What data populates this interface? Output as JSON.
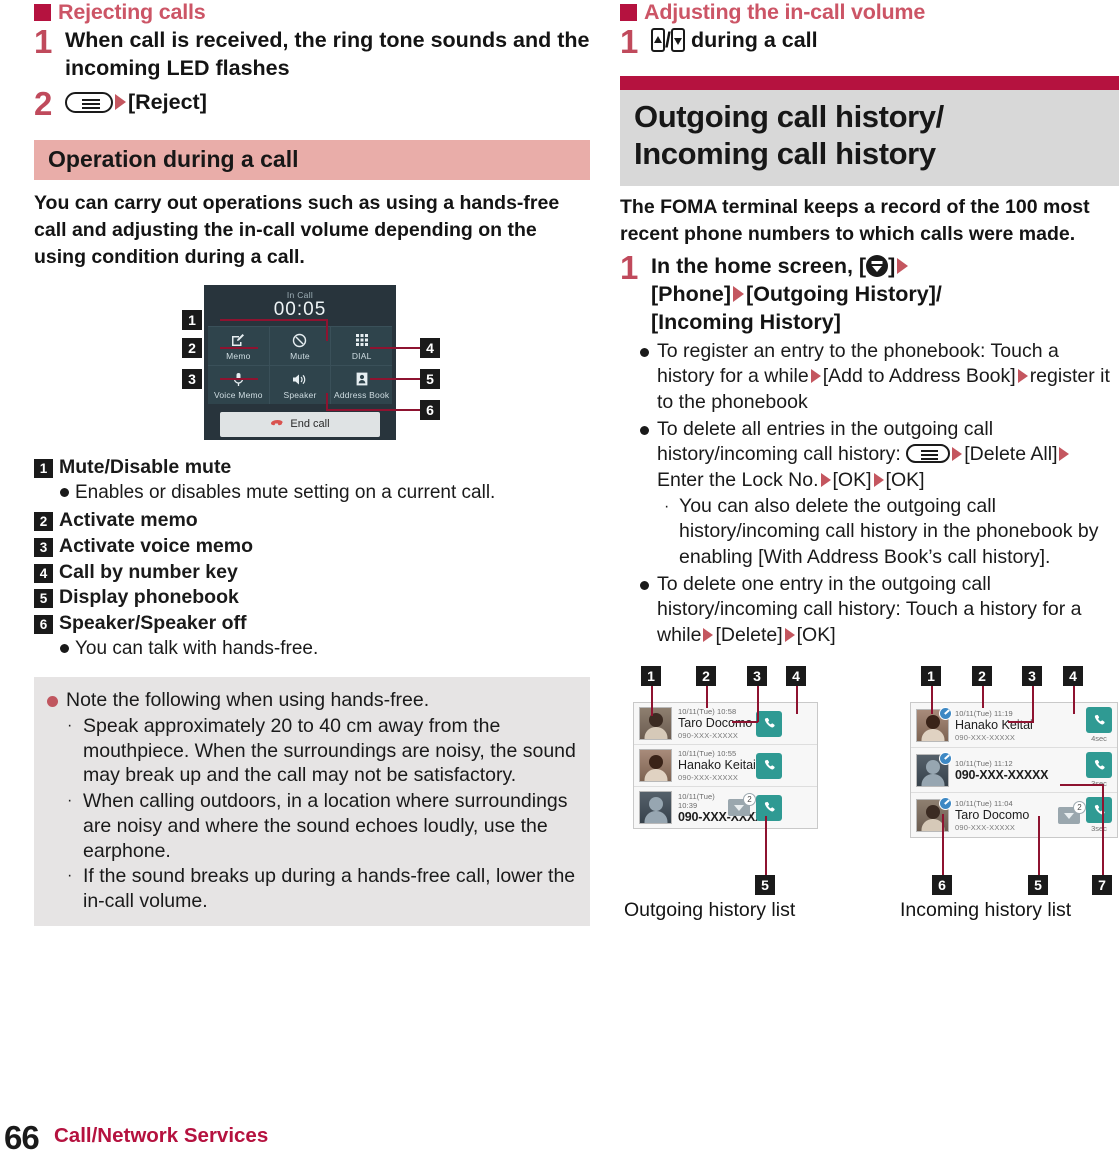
{
  "left": {
    "section1": {
      "title": "Rejecting calls"
    },
    "steps": [
      {
        "num": "1",
        "text": "When call is received, the ring tone sounds and the incoming LED flashes"
      },
      {
        "num": "2",
        "text_after": "[Reject]"
      }
    ],
    "operation_bar": "Operation during a call",
    "intro": "You can carry out operations such as using a hands-free call and adjusting the in-call volume depending on the using condition during a call.",
    "phone_mock": {
      "status": "In Call",
      "timer": "00:05",
      "cells": [
        {
          "icon": "memo-icon",
          "label": "Memo"
        },
        {
          "icon": "mute-icon",
          "label": "Mute"
        },
        {
          "icon": "dial-keypad-icon",
          "label": "DIAL"
        },
        {
          "icon": "voice-memo-icon",
          "label": "Voice Memo"
        },
        {
          "icon": "speaker-icon",
          "label": "Speaker"
        },
        {
          "icon": "address-book-icon",
          "label": "Address Book"
        }
      ],
      "end_call": "End call",
      "callouts": [
        "1",
        "2",
        "3",
        "4",
        "5",
        "6"
      ]
    },
    "definitions": [
      {
        "num": "1",
        "term": "Mute/Disable mute",
        "note": "Enables or disables mute setting on a current call."
      },
      {
        "num": "2",
        "term": "Activate memo",
        "note": ""
      },
      {
        "num": "3",
        "term": "Activate voice memo",
        "note": ""
      },
      {
        "num": "4",
        "term": "Call by number key",
        "note": ""
      },
      {
        "num": "5",
        "term": "Display phonebook",
        "note": ""
      },
      {
        "num": "6",
        "term": "Speaker/Speaker off",
        "note": "You can talk with hands-free."
      }
    ],
    "note_box": {
      "head": "Note the following when using hands-free.",
      "items": [
        "Speak approximately 20 to 40 cm away from the mouthpiece. When the surroundings are noisy, the sound may break up and the call may not be satisfactory.",
        "When calling outdoors, in a location where surroundings are noisy and where the sound echoes loudly, use the earphone.",
        "If the sound breaks up during a hands-free call, lower the in-call volume."
      ]
    }
  },
  "right": {
    "section1": {
      "title": "Adjusting the in-call volume"
    },
    "step1_text": "during a call",
    "step1_num": "1",
    "chapter_title_line1": "Outgoing call history/",
    "chapter_title_line2": "Incoming call history",
    "lead": "The FOMA terminal keeps a record of the 100 most recent phone numbers to which calls were made.",
    "step_num": "1",
    "step_a": "In the home screen, ",
    "step_b": "[Phone]",
    "step_c": "[Outgoing History]/",
    "step_d": "[Incoming History]",
    "bullets": [
      {
        "type": "dot",
        "parts": [
          "To register an entry to the phonebook: Touch a history for a while",
          "[Add to Address Book]",
          "register it to the phonebook"
        ]
      },
      {
        "type": "dot",
        "parts": [
          "To delete all entries in the outgoing call history/incoming call history:",
          "[Delete All]",
          " Enter the Lock No.",
          "[OK]",
          "[OK]"
        ]
      },
      {
        "type": "sub",
        "parts": [
          "You can also delete the outgoing call history/incoming call history in the phonebook by enabling [With Address Book’s call history]."
        ]
      },
      {
        "type": "dot",
        "parts": [
          "To delete one entry in the outgoing call history/incoming call history: Touch a history for a while",
          "[Delete]",
          "[OK]"
        ]
      }
    ],
    "outgoing_list": {
      "caption": "Outgoing history list",
      "callouts": [
        "1",
        "2",
        "3",
        "4",
        "5"
      ],
      "rows": [
        {
          "date": "10/11(Tue) 10:58",
          "name": "Taro Docomo",
          "number": "090-XXX-XXXXX",
          "avatar": "male-photo",
          "edit_badge": false,
          "dropdown": "",
          "duration": ""
        },
        {
          "date": "10/11(Tue) 10:55",
          "name": "Hanako Keitai",
          "number": "090-XXX-XXXXX",
          "avatar": "female-photo",
          "edit_badge": false,
          "dropdown": "",
          "duration": ""
        },
        {
          "date": "10/11(Tue) 10:39",
          "name": "090-XXX-XXXXX",
          "number": "",
          "avatar": "anonymous",
          "edit_badge": false,
          "dropdown": "2",
          "duration": ""
        }
      ]
    },
    "incoming_list": {
      "caption": "Incoming history list",
      "callouts": [
        "1",
        "2",
        "3",
        "4",
        "5",
        "6",
        "7"
      ],
      "rows": [
        {
          "date": "10/11(Tue) 11:19",
          "name": "Hanako Keitai",
          "number": "090-XXX-XXXXX",
          "avatar": "female-photo",
          "edit_badge": true,
          "dropdown": "",
          "duration": "4sec"
        },
        {
          "date": "10/11(Tue) 11:12",
          "name": "090-XXX-XXXXX",
          "number": "",
          "avatar": "anonymous",
          "edit_badge": true,
          "dropdown": "",
          "duration": "3sec"
        },
        {
          "date": "10/11(Tue) 11:04",
          "name": "Taro Docomo",
          "number": "090-XXX-XXXXX",
          "avatar": "male-photo",
          "edit_badge": true,
          "dropdown": "2",
          "duration": "3sec"
        }
      ]
    }
  },
  "footer": {
    "page_number": "66",
    "chapter": "Call/Network Services"
  },
  "colors": {
    "crimson": "#b5123f",
    "pink_bar": "#e9ada9",
    "heading_red": "#cc5566",
    "arrow_red": "#c4565f",
    "note_gray": "#e6e4e4",
    "chapter_gray": "#d8d8d8",
    "teal": "#2f9a93"
  }
}
